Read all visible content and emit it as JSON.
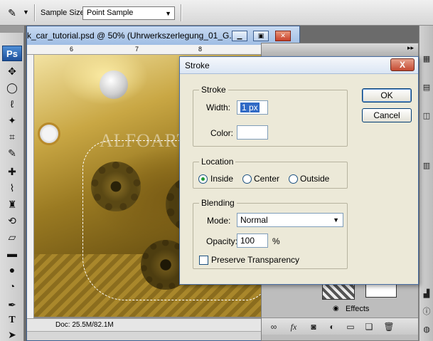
{
  "options_bar": {
    "tool_icon": "eyedropper-icon",
    "sample_size_label": "Sample Size:",
    "sample_size_value": "Point Sample"
  },
  "toolbox": {
    "logo": "Ps",
    "tools": [
      "move-icon",
      "marquee-icon",
      "lasso-icon",
      "magic-wand-icon",
      "crop-icon",
      "eyedropper-icon",
      "healing-icon",
      "brush-icon",
      "stamp-icon",
      "history-brush-icon",
      "eraser-icon",
      "gradient-icon",
      "blur-icon",
      "dodge-icon",
      "pen-icon",
      "type-icon",
      "path-select-icon"
    ],
    "type_glyph": "T"
  },
  "document": {
    "title": "k_car_tutorial.psd @ 50% (Uhrwerkszerlegung_01_G...",
    "ruler_ticks": [
      "6",
      "7",
      "8"
    ],
    "watermark": "ALFOART.COM",
    "status": "Doc: 25.5M/82.1M"
  },
  "layers_panel": {
    "effects_label": "Effects",
    "fx_glyph": "fx",
    "bottom_icons": [
      "link-icon",
      "fx-icon",
      "mask-icon",
      "adjustment-icon",
      "folder-icon",
      "new-layer-icon",
      "trash-icon"
    ]
  },
  "dialog": {
    "title": "Stroke",
    "close_glyph": "X",
    "ok_label": "OK",
    "cancel_label": "Cancel",
    "stroke": {
      "group_label": "Stroke",
      "width_label": "Width:",
      "width_value": "1 px",
      "color_label": "Color:"
    },
    "location": {
      "group_label": "Location",
      "inside": "Inside",
      "center": "Center",
      "outside": "Outside",
      "selected": "inside"
    },
    "blending": {
      "group_label": "Blending",
      "mode_label": "Mode:",
      "mode_value": "Normal",
      "opacity_label": "Opacity:",
      "opacity_value": "100",
      "opacity_unit": "%",
      "preserve_label": "Preserve Transparency",
      "preserve_checked": false
    }
  },
  "colors": {
    "dialog_bg": "#ece9d8",
    "title_bar": "#dbe6f4",
    "selection": "#316ac5"
  }
}
